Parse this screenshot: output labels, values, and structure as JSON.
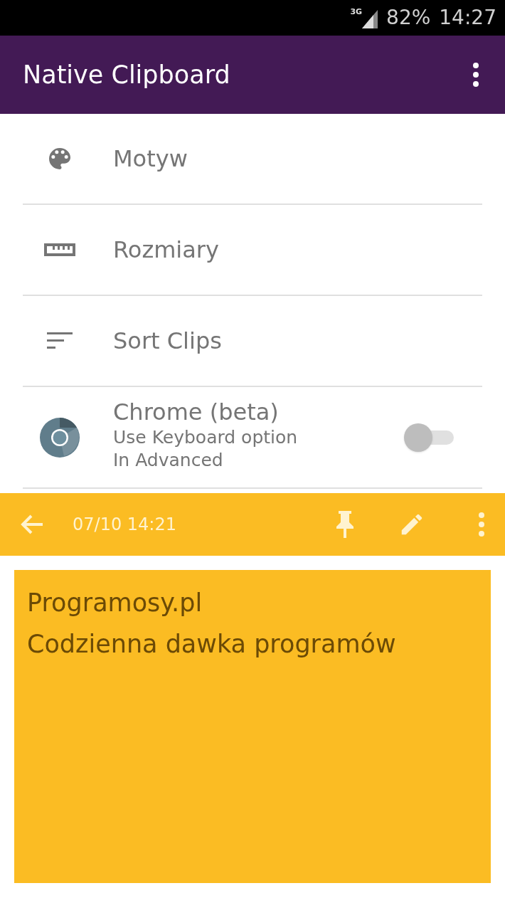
{
  "status_bar": {
    "network": "3G",
    "battery": "82%",
    "time": "14:27"
  },
  "app_bar": {
    "title": "Native Clipboard"
  },
  "settings": [
    {
      "kind": "plain",
      "label": "Motyw"
    },
    {
      "kind": "plain",
      "label": "Rozmiary"
    },
    {
      "kind": "plain",
      "label": "Sort Clips"
    },
    {
      "kind": "toggle",
      "label": "Chrome (beta)",
      "sublines": [
        "Use Keyboard option",
        "In Advanced"
      ],
      "on": false
    }
  ],
  "clip_bar": {
    "date": "07/10 14:21"
  },
  "clip": {
    "lines": [
      "Programosy.pl",
      "Codzienna dawka programów"
    ]
  }
}
